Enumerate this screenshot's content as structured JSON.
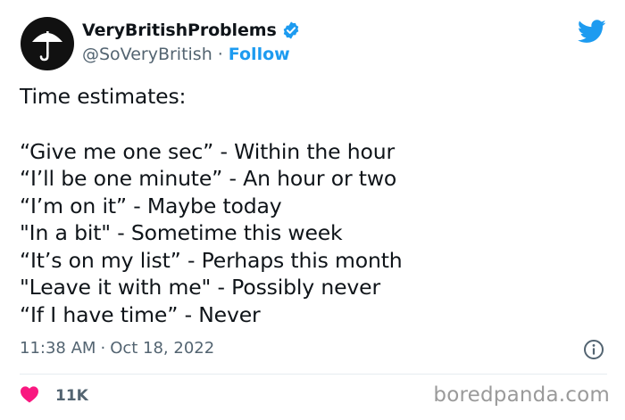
{
  "author": {
    "display_name": "VeryBritishProblems",
    "handle": "@SoVeryBritish",
    "separator": "·",
    "follow_label": "Follow",
    "avatar_icon": "umbrella-icon",
    "verified_icon": "verified-badge-icon"
  },
  "platform_icon": "twitter-bird-icon",
  "tweet": {
    "lines": [
      "Time estimates:",
      "",
      "“Give me one sec” - Within the hour",
      "“I’ll be one minute” - An hour or two",
      "“I’m on it” - Maybe today",
      "\"In a bit\" - Sometime this week",
      "“It’s on my list” - Perhaps this month",
      "\"Leave it with me\" - Possibly never",
      "“If I have time” - Never"
    ]
  },
  "meta": {
    "time": "11:38 AM",
    "separator": "·",
    "date": "Oct 18, 2022",
    "info_icon": "info-icon"
  },
  "engagement": {
    "like_icon": "heart-icon",
    "like_count": "11K"
  },
  "watermark": "boredpanda.com",
  "colors": {
    "accent": "#1d9bf0",
    "heart": "#f91880",
    "muted": "#536471",
    "text": "#0f1419"
  }
}
